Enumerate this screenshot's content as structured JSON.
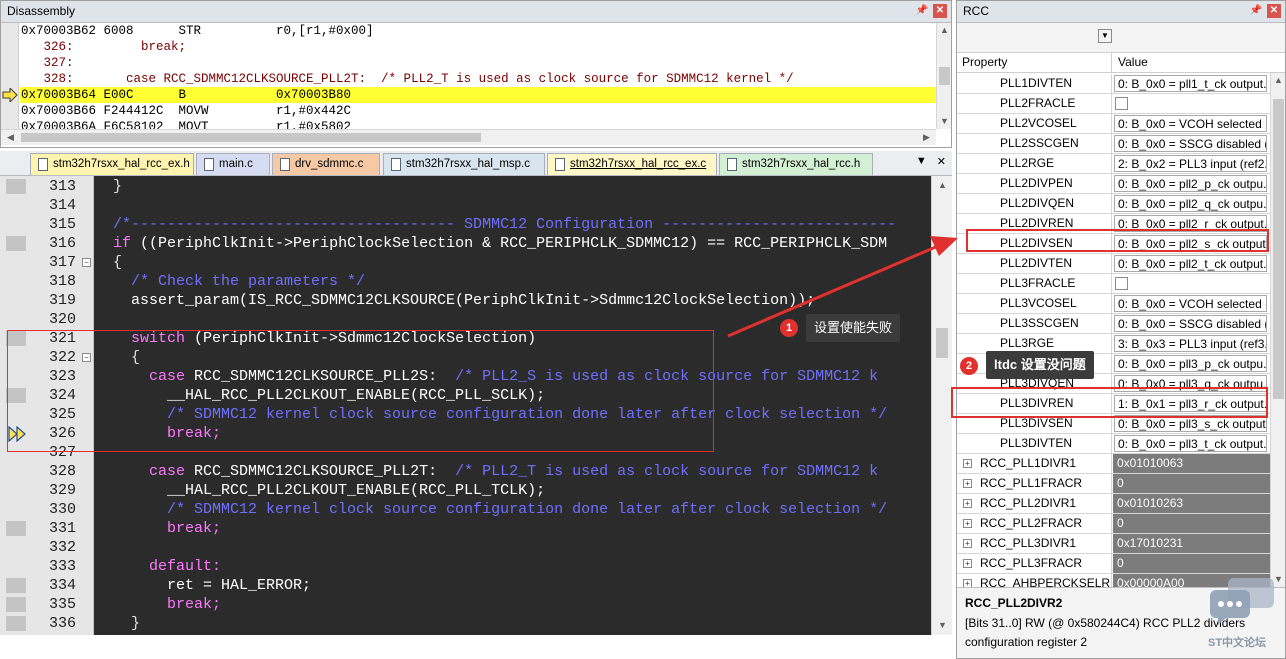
{
  "disassembly": {
    "title": "Disassembly",
    "lines": [
      {
        "text": "0x70003B62 6008      STR          r0,[r1,#0x00]",
        "type": "asm"
      },
      {
        "text": "   326:         break;",
        "type": "src"
      },
      {
        "text": "   327:",
        "type": "src"
      },
      {
        "text": "   328:       case RCC_SDMMC12CLKSOURCE_PLL2T:  /* PLL2_T is used as clock source for SDMMC12 kernel */",
        "type": "src"
      },
      {
        "text": "0x70003B64 E00C      B            0x70003B80",
        "type": "cur"
      },
      {
        "text": "0x70003B66 F244412C  MOVW         r1,#0x442C",
        "type": "asm"
      },
      {
        "text": "0x70003B6A F6C58102  MOVT         r1,#0x5802",
        "type": "asm"
      }
    ]
  },
  "tabs": [
    {
      "label": "stm32h7rsxx_hal_rcc_ex.h",
      "color": "#fff3b0"
    },
    {
      "label": "main.c",
      "color": "#d6ddf2"
    },
    {
      "label": "drv_sdmmc.c",
      "color": "#f5c9a6"
    },
    {
      "label": "stm32h7rsxx_hal_msp.c",
      "color": "#d8e4ee"
    },
    {
      "label": "stm32h7rsxx_hal_rcc_ex.c",
      "color": "#fff7c6"
    },
    {
      "label": "stm32h7rsxx_hal_rcc.h",
      "color": "#d4f0d4"
    }
  ],
  "tab_tools": {
    "menu": "▼",
    "close": "✕"
  },
  "code": [
    {
      "num": "313",
      "text": "  }",
      "kind": "plain"
    },
    {
      "num": "314",
      "text": "",
      "kind": "plain"
    },
    {
      "num": "315",
      "text": "  /*------------------------------------ SDMMC12 Configuration --------------------------",
      "kind": "comment"
    },
    {
      "num": "316",
      "text": "  if ((PeriphClkInit->PeriphClockSelection & RCC_PERIPHCLK_SDMMC12) == RCC_PERIPHCLK_SDM",
      "kind": "if"
    },
    {
      "num": "317",
      "text": "  {",
      "kind": "plain"
    },
    {
      "num": "318",
      "text": "    /* Check the parameters */",
      "kind": "comment"
    },
    {
      "num": "319",
      "text": "    assert_param(IS_RCC_SDMMC12CLKSOURCE(PeriphClkInit->Sdmmc12ClockSelection));",
      "kind": "white"
    },
    {
      "num": "320",
      "text": "",
      "kind": "plain"
    },
    {
      "num": "321",
      "text": "    switch (PeriphClkInit->Sdmmc12ClockSelection)",
      "kind": "switch"
    },
    {
      "num": "322",
      "text": "    {",
      "kind": "plain"
    },
    {
      "num": "323",
      "text": "      case RCC_SDMMC12CLKSOURCE_PLL2S:  /* PLL2_S is used as clock source for SDMMC12 k",
      "kind": "case"
    },
    {
      "num": "324",
      "text": "        __HAL_RCC_PLL2CLKOUT_ENABLE(RCC_PLL_SCLK);",
      "kind": "white"
    },
    {
      "num": "325",
      "text": "        /* SDMMC12 kernel clock source configuration done later after clock selection */",
      "kind": "comment"
    },
    {
      "num": "326",
      "text": "        break;",
      "kind": "kw"
    },
    {
      "num": "327",
      "text": "",
      "kind": "plain"
    },
    {
      "num": "328",
      "text": "      case RCC_SDMMC12CLKSOURCE_PLL2T:  /* PLL2_T is used as clock source for SDMMC12 k",
      "kind": "case"
    },
    {
      "num": "329",
      "text": "        __HAL_RCC_PLL2CLKOUT_ENABLE(RCC_PLL_TCLK);",
      "kind": "white"
    },
    {
      "num": "330",
      "text": "        /* SDMMC12 kernel clock source configuration done later after clock selection */",
      "kind": "comment"
    },
    {
      "num": "331",
      "text": "        break;",
      "kind": "kw"
    },
    {
      "num": "332",
      "text": "",
      "kind": "plain"
    },
    {
      "num": "333",
      "text": "      default:",
      "kind": "kw"
    },
    {
      "num": "334",
      "text": "        ret = HAL_ERROR;",
      "kind": "white"
    },
    {
      "num": "335",
      "text": "        break;",
      "kind": "kw"
    },
    {
      "num": "336",
      "text": "    }",
      "kind": "plain"
    }
  ],
  "rcc": {
    "title": "RCC",
    "col_property": "Property",
    "col_value": "Value",
    "rows": [
      {
        "name": "PLL1DIVTEN",
        "value": "0: B_0x0 = pll1_t_ck output...",
        "kind": "combo",
        "indent": true
      },
      {
        "name": "PLL2FRACLE",
        "value": "",
        "kind": "check",
        "indent": true
      },
      {
        "name": "PLL2VCOSEL",
        "value": "0: B_0x0 = VCOH selected (...",
        "kind": "combo",
        "indent": true
      },
      {
        "name": "PLL2SSCGEN",
        "value": "0: B_0x0 = SSCG disabled (...",
        "kind": "combo",
        "indent": true
      },
      {
        "name": "PLL2RGE",
        "value": "2: B_0x2 = PLL3 input (ref2...",
        "kind": "combo",
        "indent": true
      },
      {
        "name": "PLL2DIVPEN",
        "value": "0: B_0x0 = pll2_p_ck outpu...",
        "kind": "combo",
        "indent": true
      },
      {
        "name": "PLL2DIVQEN",
        "value": "0: B_0x0 = pll2_q_ck outpu...",
        "kind": "combo",
        "indent": true
      },
      {
        "name": "PLL2DIVREN",
        "value": "0: B_0x0 = pll2_r_ck output...",
        "kind": "combo",
        "indent": true
      },
      {
        "name": "PLL2DIVSEN",
        "value": "0: B_0x0 = pll2_s_ck output...",
        "kind": "combo",
        "indent": true
      },
      {
        "name": "PLL2DIVTEN",
        "value": "0: B_0x0 = pll2_t_ck output...",
        "kind": "combo",
        "indent": true
      },
      {
        "name": "PLL3FRACLE",
        "value": "",
        "kind": "check",
        "indent": true
      },
      {
        "name": "PLL3VCOSEL",
        "value": "0: B_0x0 = VCOH selected (...",
        "kind": "combo",
        "indent": true
      },
      {
        "name": "PLL3SSCGEN",
        "value": "0: B_0x0 = SSCG disabled (...",
        "kind": "combo",
        "indent": true
      },
      {
        "name": "PLL3RGE",
        "value": "3: B_0x3 = PLL3 input (ref3...",
        "kind": "combo",
        "indent": true
      },
      {
        "name": "PLL3DIVPEN",
        "value": "0: B_0x0 = pll3_p_ck outpu...",
        "kind": "combo",
        "indent": true
      },
      {
        "name": "PLL3DIVQEN",
        "value": "0: B_0x0 = pll3_q_ck outpu...",
        "kind": "combo",
        "indent": true
      },
      {
        "name": "PLL3DIVREN",
        "value": "1: B_0x1 = pll3_r_ck output...",
        "kind": "combo",
        "indent": true
      },
      {
        "name": "PLL3DIVSEN",
        "value": "0: B_0x0 = pll3_s_ck output...",
        "kind": "combo",
        "indent": true
      },
      {
        "name": "PLL3DIVTEN",
        "value": "0: B_0x0 = pll3_t_ck output...",
        "kind": "combo",
        "indent": true
      },
      {
        "name": "RCC_PLL1DIVR1",
        "value": "0x01010063",
        "kind": "reg",
        "indent": false
      },
      {
        "name": "RCC_PLL1FRACR",
        "value": "0",
        "kind": "reg",
        "indent": false
      },
      {
        "name": "RCC_PLL2DIVR1",
        "value": "0x01010263",
        "kind": "reg",
        "indent": false
      },
      {
        "name": "RCC_PLL2FRACR",
        "value": "0",
        "kind": "reg",
        "indent": false
      },
      {
        "name": "RCC_PLL3DIVR1",
        "value": "0x17010231",
        "kind": "reg",
        "indent": false
      },
      {
        "name": "RCC_PLL3FRACR",
        "value": "0",
        "kind": "reg",
        "indent": false
      },
      {
        "name": "RCC_AHBPERCKSELR",
        "value": "0x00000A00",
        "kind": "reg",
        "indent": false
      }
    ],
    "desc_title": "RCC_PLL2DIVR2",
    "desc_line1": "[Bits 31..0] RW (@ 0x580244C4) RCC PLL2 dividers",
    "desc_line2": "configuration register 2"
  },
  "annotations": {
    "callout1": {
      "num": "1",
      "text": "设置使能失败"
    },
    "callout2": {
      "num": "2",
      "text": "ltdc 设置没问题"
    }
  },
  "watermark": {
    "text": "ST中文论坛"
  },
  "colors": {
    "highlight": "#ffff33",
    "annotation_red": "#e0312f",
    "editor_bg": "#2b2b2b"
  }
}
